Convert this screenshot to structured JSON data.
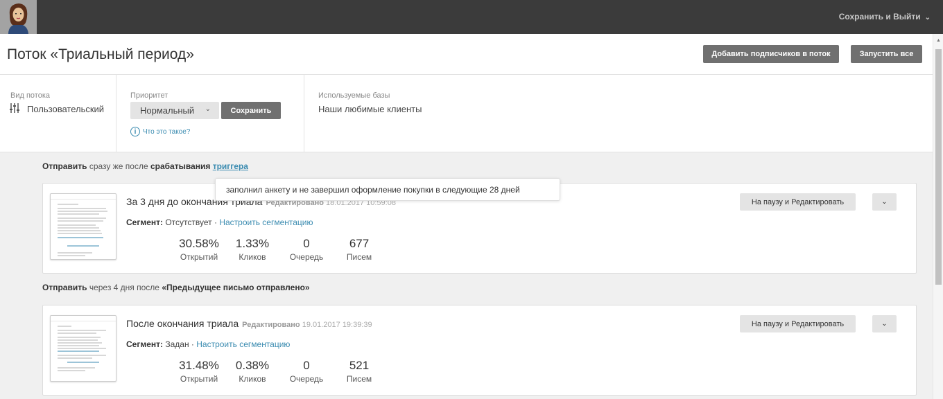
{
  "topbar": {
    "save_exit": "Сохранить и Выйти",
    "avatar_icon": "user-avatar"
  },
  "header": {
    "title": "Поток «Триальный период»",
    "add_subscribers": "Добавить подписчиков в поток",
    "start_all": "Запустить все"
  },
  "settings": {
    "flow_type_label": "Вид потока",
    "flow_type_value": "Пользовательский",
    "priority_label": "Приоритет",
    "priority_value": "Нормальный",
    "save_label": "Сохранить",
    "help_text": "Что это такое?",
    "bases_label": "Используемые базы",
    "bases_value": "Наши любимые клиенты"
  },
  "condition1": {
    "t1": "Отправить",
    "t2": " сразу же после ",
    "t3": "срабатывания",
    "link": "триггера"
  },
  "tooltip": {
    "text": "заполнил анкету и не завершил оформление покупки в следующие 28 дней"
  },
  "condition2": {
    "t1": "Отправить",
    "t2": " через 4 дня после ",
    "t3": "«Предыдущее письмо отправлено»"
  },
  "emails": [
    {
      "title": "За 3 дня до окончания триала",
      "edited_label": "Редактировано",
      "edited_date": "18.01.2017 10:59:08",
      "segment_label": "Сегмент:",
      "segment_value": " Отсутствует · ",
      "segment_link": "Настроить сегментацию",
      "stats": [
        {
          "value": "30.58%",
          "label": "Открытий"
        },
        {
          "value": "1.33%",
          "label": "Кликов"
        },
        {
          "value": "0",
          "label": "Очередь"
        },
        {
          "value": "677",
          "label": "Писем"
        }
      ],
      "action": "На паузу и Редактировать"
    },
    {
      "title": "После окончания триала",
      "edited_label": "Редактировано",
      "edited_date": "19.01.2017 19:39:39",
      "segment_label": "Сегмент:",
      "segment_value": " Задан · ",
      "segment_link": "Настроить сегментацию",
      "stats": [
        {
          "value": "31.48%",
          "label": "Открытий"
        },
        {
          "value": "0.38%",
          "label": "Кликов"
        },
        {
          "value": "0",
          "label": "Очередь"
        },
        {
          "value": "521",
          "label": "Писем"
        }
      ],
      "action": "На паузу и Редактировать"
    }
  ],
  "colors": {
    "topbar": "#3b3b3b",
    "link": "#3a8bb0",
    "dark_button": "#707070"
  }
}
